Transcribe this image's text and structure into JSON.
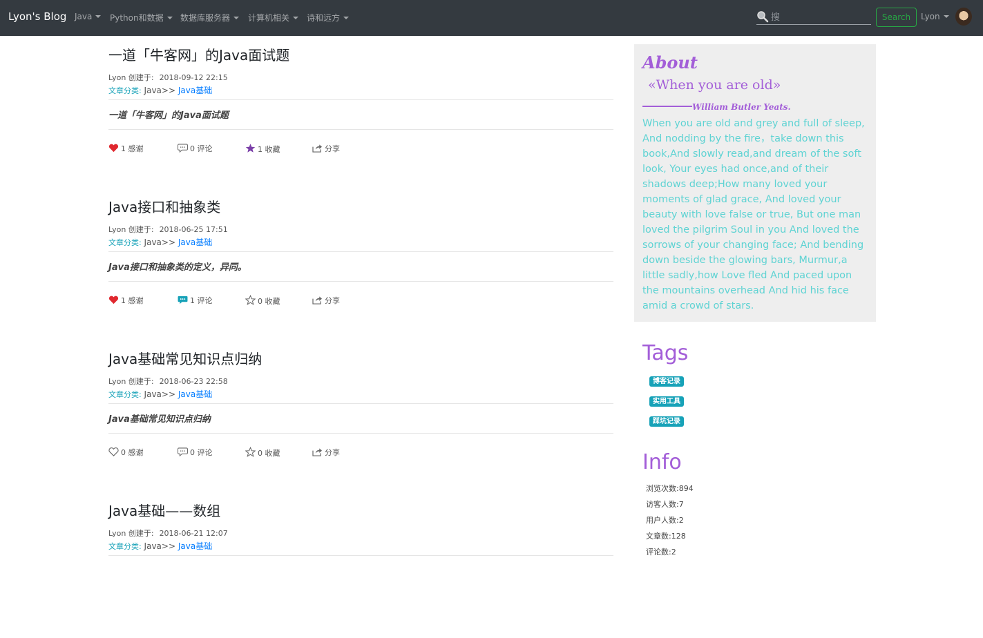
{
  "navbar": {
    "brand": "Lyon's Blog",
    "menus": [
      "Java",
      "Python和数据",
      "数据库服务器",
      "计算机相关",
      "诗和远方"
    ],
    "search_placeholder": "搜",
    "search_button": "Search",
    "user_label": "Lyon"
  },
  "posts": [
    {
      "title": "一道「牛客网」的Java面试题",
      "author": "Lyon",
      "created_label": "创建于:",
      "date": "2018-09-12 22:15",
      "category_label": "文章分类:",
      "category_parent": "Java>>",
      "category_child": "Java基础",
      "summary": "一道「牛客网」的Java面试题",
      "thanks": "1 感谢",
      "comments": "0 评论",
      "favorites": "1 收藏",
      "share": "分享",
      "liked": true,
      "commented": false,
      "favorited": true
    },
    {
      "title": "Java接口和抽象类",
      "author": "Lyon",
      "created_label": "创建于:",
      "date": "2018-06-25 17:51",
      "category_label": "文章分类:",
      "category_parent": "Java>>",
      "category_child": "Java基础",
      "summary": "Java接口和抽象类的定义，异同。",
      "thanks": "1 感谢",
      "comments": "1 评论",
      "favorites": "0 收藏",
      "share": "分享",
      "liked": true,
      "commented": true,
      "favorited": false
    },
    {
      "title": "Java基础常见知识点归纳",
      "author": "Lyon",
      "created_label": "创建于:",
      "date": "2018-06-23 22:58",
      "category_label": "文章分类:",
      "category_parent": "Java>>",
      "category_child": "Java基础",
      "summary": "Java基础常见知识点归纳",
      "thanks": "0 感谢",
      "comments": "0 评论",
      "favorites": "0 收藏",
      "share": "分享",
      "liked": false,
      "commented": false,
      "favorited": false
    },
    {
      "title": "Java基础——数组",
      "author": "Lyon",
      "created_label": "创建于:",
      "date": "2018-06-21 12:07",
      "category_label": "文章分类:",
      "category_parent": "Java>>",
      "category_child": "Java基础"
    }
  ],
  "about": {
    "heading": "About",
    "poem_title": "«When you are old»",
    "poem_author": "William Butler Yeats.",
    "poem_body": "When you are old and grey and full of sleep, And nodding by the fire，take down this book,And slowly read,and dream of the soft look, Your eyes had once,and of their shadows deep;How many loved your moments of glad grace, And loved your beauty with love false or true, But one man loved the pilgrim Soul in you And loved the sorrows of your changing face; And bending down beside the glowing bars, Murmur,a little sadly,how Love fled And paced upon the mountains overhead And hid his face amid a crowd of stars."
  },
  "tags": {
    "heading": "Tags",
    "items": [
      "博客记录",
      "实用工具",
      "踩坑记录"
    ]
  },
  "info": {
    "heading": "Info",
    "lines": [
      "浏览次数:894",
      "访客人数:7",
      "用户人数:2",
      "文章数:128",
      "评论数:2"
    ]
  },
  "colors": {
    "navbar": "#343a40",
    "accent_purple": "#a35ed8",
    "poem_text": "#5fd3d3",
    "tag_bg": "#17a2b8",
    "link": "#007bff",
    "heart": "#e0282f",
    "star": "#7b3fa8",
    "comment_active": "#17a2b8"
  },
  "icons": {
    "search": "search-icon",
    "heart": "heart-icon",
    "comment": "comment-icon",
    "star": "star-icon",
    "share": "share-icon"
  }
}
